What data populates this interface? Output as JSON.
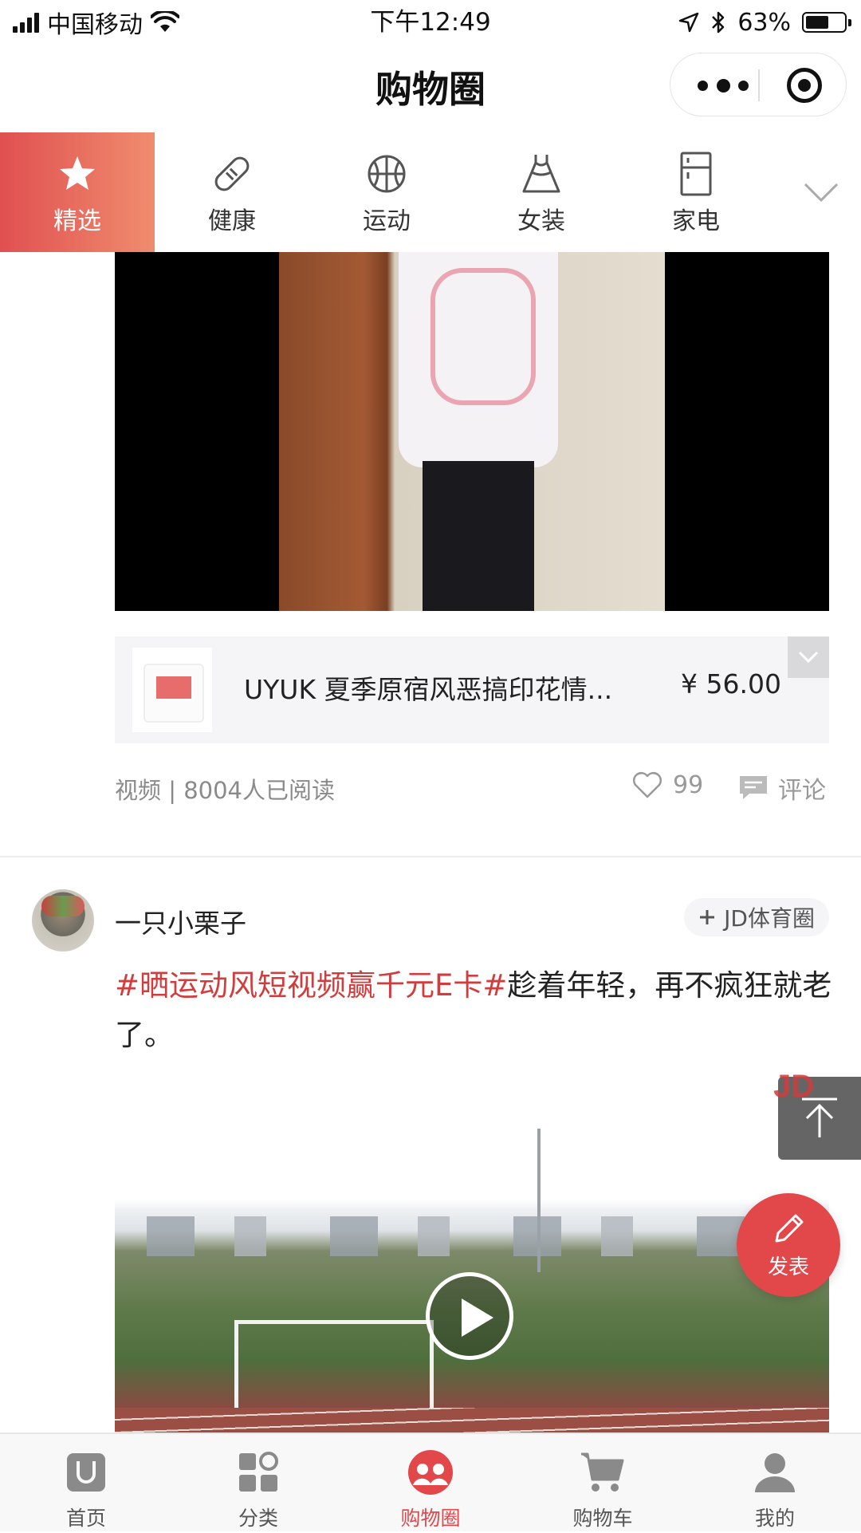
{
  "status_bar": {
    "carrier": "中国移动",
    "time": "下午12:49",
    "battery_percent": "63%",
    "battery_level": 0.63
  },
  "nav": {
    "title": "购物圈"
  },
  "category_tabs": [
    {
      "label": "精选",
      "icon": "star-icon",
      "active": true
    },
    {
      "label": "健康",
      "icon": "pill-icon",
      "active": false
    },
    {
      "label": "运动",
      "icon": "basketball-icon",
      "active": false
    },
    {
      "label": "女装",
      "icon": "dress-icon",
      "active": false
    },
    {
      "label": "家电",
      "icon": "fridge-icon",
      "active": false
    }
  ],
  "post1": {
    "product_name": "UYUK 夏季原宿风恶搞印花情...",
    "product_price": "¥ 56.00",
    "meta": "视频 | 8004人已阅读",
    "likes": "99",
    "comment_label": "评论"
  },
  "post2": {
    "username": "一只小栗子",
    "circle_tag": "JD体育圈",
    "hashtag": "#晒运动风短视频赢千元E卡#",
    "text": "趁着年轻，再不疯狂就老了。"
  },
  "floating": {
    "publish_label": "发表",
    "back_top_logo": "JD"
  },
  "tab_bar": [
    {
      "label": "首页",
      "icon": "home-icon",
      "active": false
    },
    {
      "label": "分类",
      "icon": "category-icon",
      "active": false
    },
    {
      "label": "购物圈",
      "icon": "shopping-circle-icon",
      "active": true
    },
    {
      "label": "购物车",
      "icon": "cart-icon",
      "active": false
    },
    {
      "label": "我的",
      "icon": "profile-icon",
      "active": false
    }
  ],
  "colors": {
    "accent": "#e2474a",
    "hashtag": "#d23c3c",
    "tab_active_gradient_start": "#e05050",
    "tab_active_gradient_end": "#f08c6e"
  }
}
